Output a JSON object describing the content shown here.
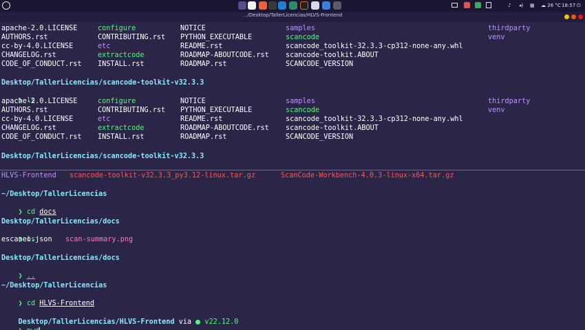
{
  "system_bar": {
    "temperature": "26 °C",
    "clock": "18:57",
    "accent": "#e36c1a"
  },
  "window": {
    "title": ".../Desktop/TallerLicencias/HLVS-Frontend"
  },
  "pane_top": {
    "listing_1": {
      "col1": [
        "apache-2.0.LICENSE",
        "AUTHORS.rst",
        "cc-by-4.0.LICENSE",
        "CHANGELOG.rst",
        "CODE_OF_CONDUCT.rst"
      ],
      "col2": [
        "configure",
        "CONTRIBUTING.rst",
        "etc",
        "extractcode",
        "INSTALL.rst"
      ],
      "col3": [
        "NOTICE",
        "PYTHON_EXECUTABLE",
        "README.rst",
        "ROADMAP-ABOUTCODE.rst",
        "ROADMAP.rst"
      ],
      "col4": [
        "samples",
        "scancode",
        "scancode_toolkit-32.3.3-cp312-none-any.whl",
        "scancode-toolkit.ABOUT",
        "SCANCODE_VERSION"
      ],
      "col5": [
        "thirdparty",
        "venv"
      ]
    },
    "prompt_1": "Desktop/TallerLicencias/scancode-toolkit-v32.3.3",
    "command_1": "ls",
    "listing_2": {
      "col1": [
        "apache-2.0.LICENSE",
        "AUTHORS.rst",
        "cc-by-4.0.LICENSE",
        "CHANGELOG.rst",
        "CODE_OF_CONDUCT.rst"
      ],
      "col2": [
        "configure",
        "CONTRIBUTING.rst",
        "etc",
        "extractcode",
        "INSTALL.rst"
      ],
      "col3": [
        "NOTICE",
        "PYTHON_EXECUTABLE",
        "README.rst",
        "ROADMAP-ABOUTCODE.rst",
        "ROADMAP.rst"
      ],
      "col4": [
        "samples",
        "scancode",
        "scancode_toolkit-32.3.3-cp312-none-any.whl",
        "scancode-toolkit.ABOUT",
        "SCANCODE_VERSION"
      ],
      "col5": [
        "thirdparty",
        "venv"
      ]
    },
    "prompt_2": "Desktop/TallerLicencias/scancode-toolkit-v32.3.3",
    "prompt_symbol": "❯"
  },
  "pane_bottom": {
    "listing_top": [
      "HLVS-Frontend",
      "scancode-toolkit-v32.3.3_py3.12-linux.tar.gz",
      "ScanCode-Workbench-4.0.3-linux-x64.tar.gz"
    ],
    "prompt_a": "~/Desktop/TallerLicencias",
    "cmd_a_word": "cd",
    "cmd_a_arg": "docs",
    "prompt_b": "Desktop/TallerLicencias/docs",
    "cmd_b": "ls",
    "listing_b": [
      "escaneo.json",
      "scan-summary.png"
    ],
    "prompt_c": "Desktop/TallerLicencias/docs",
    "cmd_c": "..",
    "prompt_d": "~/Desktop/TallerLicencias",
    "cmd_d_word": "cd",
    "cmd_d_arg": "HLVS-Frontend",
    "prompt_e": "Desktop/TallerLicencias/HLVS-Frontend",
    "via": "via",
    "node_version": "v22.12.0",
    "current_input": "pwd",
    "prompt_symbol": "❯"
  }
}
